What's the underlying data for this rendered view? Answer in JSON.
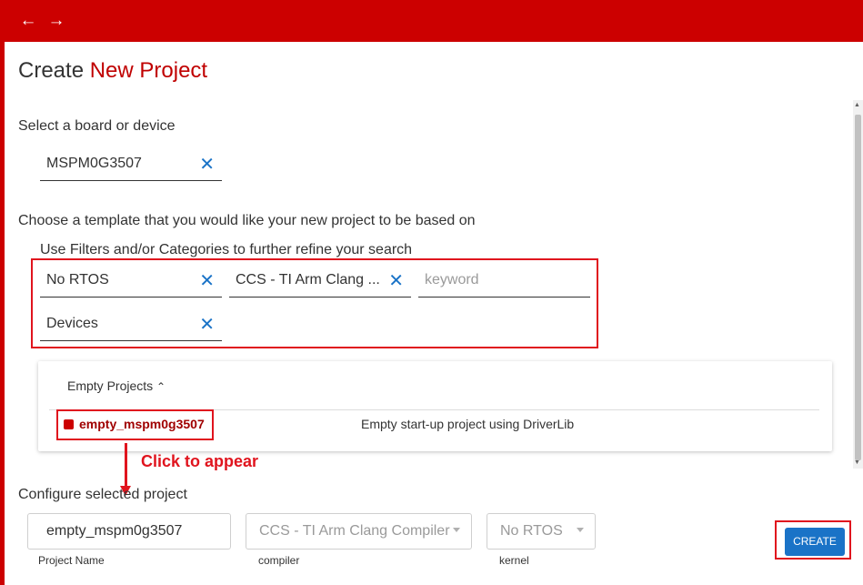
{
  "nav": {
    "back_icon": "←",
    "forward_icon": "→"
  },
  "page": {
    "title_prefix": "Create",
    "title_accent": "New Project"
  },
  "board": {
    "section_label": "Select a board or device",
    "value": "MSPM0G3507",
    "clear_icon": "✕"
  },
  "template": {
    "section_label": "Choose a template that you would like your new project to be based on",
    "filters_hint": "Use Filters and/or Categories to further refine your search",
    "filters": [
      {
        "value": "No RTOS",
        "clear_icon": "✕"
      },
      {
        "value": "CCS - TI Arm Clang ...",
        "clear_icon": "✕"
      },
      {
        "value": "Devices",
        "clear_icon": "✕"
      }
    ],
    "keyword_placeholder": "keyword"
  },
  "results": {
    "category_label": "Empty Projects",
    "collapse_icon": "⌃",
    "items": [
      {
        "name": "empty_mspm0g3507",
        "description": "Empty start-up project using DriverLib",
        "icon": "cube-icon"
      }
    ]
  },
  "annotation": {
    "text": "Click to appear"
  },
  "configure": {
    "section_label": "Configure selected project",
    "project_name": {
      "value": "empty_mspm0g3507",
      "label": "Project Name"
    },
    "compiler": {
      "value": "CCS - TI Arm Clang Compiler",
      "label": "compiler"
    },
    "kernel": {
      "value": "No RTOS",
      "label": "kernel"
    },
    "create_label": "CREATE"
  },
  "colors": {
    "brand_red": "#cc0000",
    "annotation_red": "#e0141e",
    "accent_blue": "#1a73c7"
  }
}
